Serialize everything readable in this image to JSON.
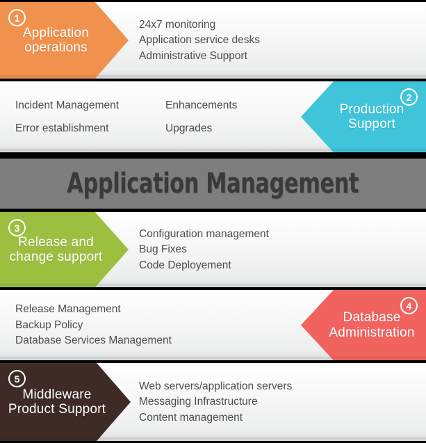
{
  "title": "Application Management",
  "colors": {
    "orange": "#f0914e",
    "cyan": "#3fc4da",
    "green": "#9cbf40",
    "salmon": "#f0635e",
    "brown": "#3e2b26",
    "band_gray": "#7e7e7e",
    "text_gray": "#4c4c4c",
    "panel": "#f2f2f2"
  },
  "sections": [
    {
      "number": "1",
      "label": "Application\noperations",
      "color": "#f0914e",
      "side": "left",
      "items": [
        "24x7 monitoring",
        "Application service desks",
        "Administrative Support"
      ]
    },
    {
      "number": "2",
      "label": "Production\nSupport",
      "color": "#3fc4da",
      "side": "right",
      "items": [
        "Incident Management",
        "Enhancements",
        "Error establishment",
        "Upgrades"
      ]
    },
    {
      "number": "3",
      "label": "Release and\nchange support",
      "color": "#9cbf40",
      "side": "left",
      "items": [
        "Configuration management",
        "Bug Fixes",
        "Code Deployement"
      ]
    },
    {
      "number": "4",
      "label": "Database\nAdministration",
      "color": "#f0635e",
      "side": "right",
      "items": [
        "Release Management",
        "Backup Policy",
        "Database Services Management"
      ]
    },
    {
      "number": "5",
      "label": "Middleware\nProduct Support",
      "color": "#3e2b26",
      "side": "left",
      "items": [
        "Web servers/application servers",
        "Messaging Infrastructure",
        "Content management"
      ]
    }
  ]
}
